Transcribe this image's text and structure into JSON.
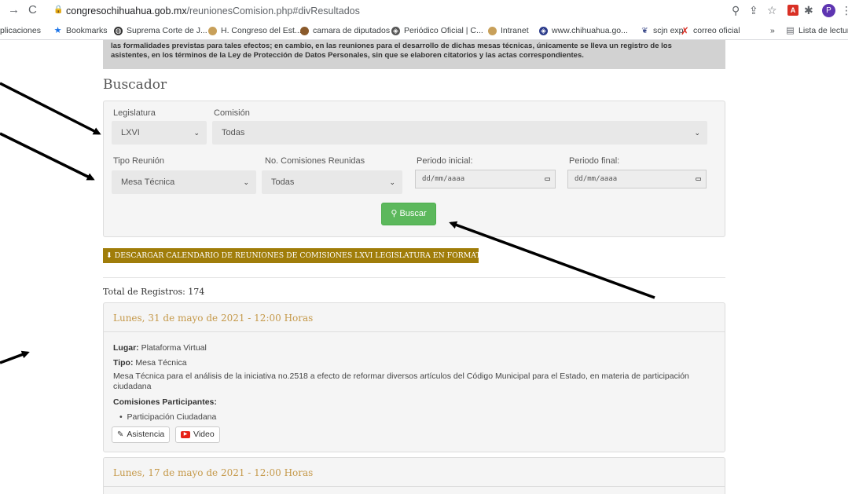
{
  "browser": {
    "url_host": "congresochihuahua.gob.mx",
    "url_path": "/reunionesComision.php#divResultados",
    "bookmarks": [
      {
        "label": "plicaciones"
      },
      {
        "label": "Bookmarks"
      },
      {
        "label": "Suprema Corte de J..."
      },
      {
        "label": "H. Congreso del Est..."
      },
      {
        "label": "camara de diputados"
      },
      {
        "label": "Periódico Oficial | C..."
      },
      {
        "label": "Intranet"
      },
      {
        "label": "www.chihuahua.go..."
      },
      {
        "label": "scjn exp"
      },
      {
        "label": "correo oficial"
      },
      {
        "label": "Lista de lectur"
      }
    ],
    "more": "»",
    "avatar": "P"
  },
  "notice": {
    "line1": "las formalidades previstas para tales efectos; en cambio, en las reuniones para el desarrollo de dichas mesas técnicas, únicamente se lleva un registro de los",
    "line2": "asistentes, en los términos de la Ley de Protección de Datos Personales, sin que se elaboren citatorios y las actas correspondientes."
  },
  "search": {
    "title": "Buscador",
    "legislatura_label": "Legislatura",
    "legislatura_value": "LXVI",
    "comision_label": "Comisión",
    "comision_value": "Todas",
    "tipo_label": "Tipo Reunión",
    "tipo_value": "Mesa Técnica",
    "no_comisiones_label": "No. Comisiones Reunidas",
    "no_comisiones_value": "Todas",
    "periodo_inicial_label": "Periodo inicial:",
    "periodo_inicial_placeholder": "dd/mm/aaaa",
    "periodo_final_label": "Periodo final:",
    "periodo_final_placeholder": "dd/mm/aaaa",
    "buscar_label": "Buscar"
  },
  "csv_button": "DESCARGAR CALENDARIO DE REUNIONES DE COMISIONES LXVI LEGISLATURA EN FORMATO CSV",
  "total": "Total de Registros: 174",
  "results": [
    {
      "heading": "Lunes, 31 de mayo de 2021 - 12:00 Horas",
      "lugar_label": "Lugar:",
      "lugar": "Plataforma Virtual",
      "tipo_label": "Tipo:",
      "tipo": "Mesa Técnica",
      "description": "Mesa Técnica para el análisis de la iniciativa no.2518 a efecto de reformar diversos artículos del Código Municipal para el Estado, en materia de participación ciudadana",
      "participantes_label": "Comisiones Participantes:",
      "participantes": [
        "Participación Ciudadana"
      ],
      "asistencia_label": "Asistencia",
      "video_label": "Video"
    },
    {
      "heading": "Lunes, 17 de mayo de 2021 - 12:00 Horas"
    }
  ],
  "colors": {
    "accent_green": "#5cb85c",
    "csv_gold": "#a07d0a",
    "heading_gold": "#c5994a",
    "panel_bg": "#f5f5f5"
  }
}
